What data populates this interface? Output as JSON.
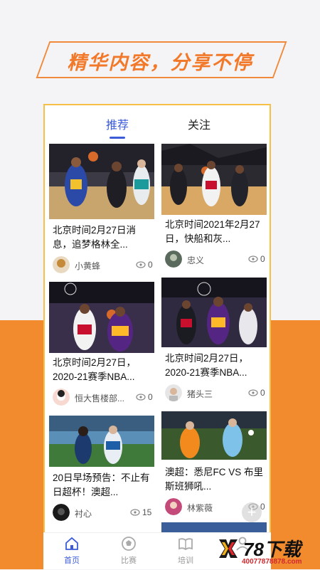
{
  "banner": {
    "text": "精华内容，分享不停"
  },
  "tabs": [
    {
      "label": "推荐",
      "active": true
    },
    {
      "label": "关注",
      "active": false
    }
  ],
  "cards": [
    {
      "title": "北京时间2月27日消息，追梦格林全...",
      "author": "小黄蜂",
      "views": "0",
      "image": "basketball-warriors-photo"
    },
    {
      "title": "北京时间2021年2月27日，快船和灰...",
      "author": "忠义",
      "views": "0",
      "image": "basketball-clippers-photo"
    },
    {
      "title": "北京时间2月27日，2020-21赛季NBA...",
      "author": "恒大售楼部...",
      "views": "0",
      "image": "basketball-lakers-photo"
    },
    {
      "title": "北京时间2月27日，2020-21赛季NBA...",
      "author": "猪头三",
      "views": "0",
      "image": "basketball-lakers-blazers-photo"
    },
    {
      "title": "20日早场预告：不止有日超杯！澳超...",
      "author": "衬心",
      "views": "15",
      "image": "soccer-japan-photo"
    },
    {
      "title": "澳超：悉尼FC VS 布里斯班狮吼...",
      "author": "林紫薇",
      "views": "0",
      "image": "soccer-australia-photo"
    }
  ],
  "nav": [
    {
      "label": "首页",
      "icon": "home-icon",
      "active": true
    },
    {
      "label": "比赛",
      "icon": "ball-icon",
      "active": false
    },
    {
      "label": "培训",
      "icon": "book-icon",
      "active": false
    },
    {
      "label": "",
      "icon": "profile-icon",
      "active": false
    }
  ],
  "watermark": {
    "name": "78下载",
    "url": "40077878878.com"
  },
  "colors": {
    "accent": "#3b5bd9",
    "orange": "#f28a2e",
    "border": "#f5c045"
  }
}
